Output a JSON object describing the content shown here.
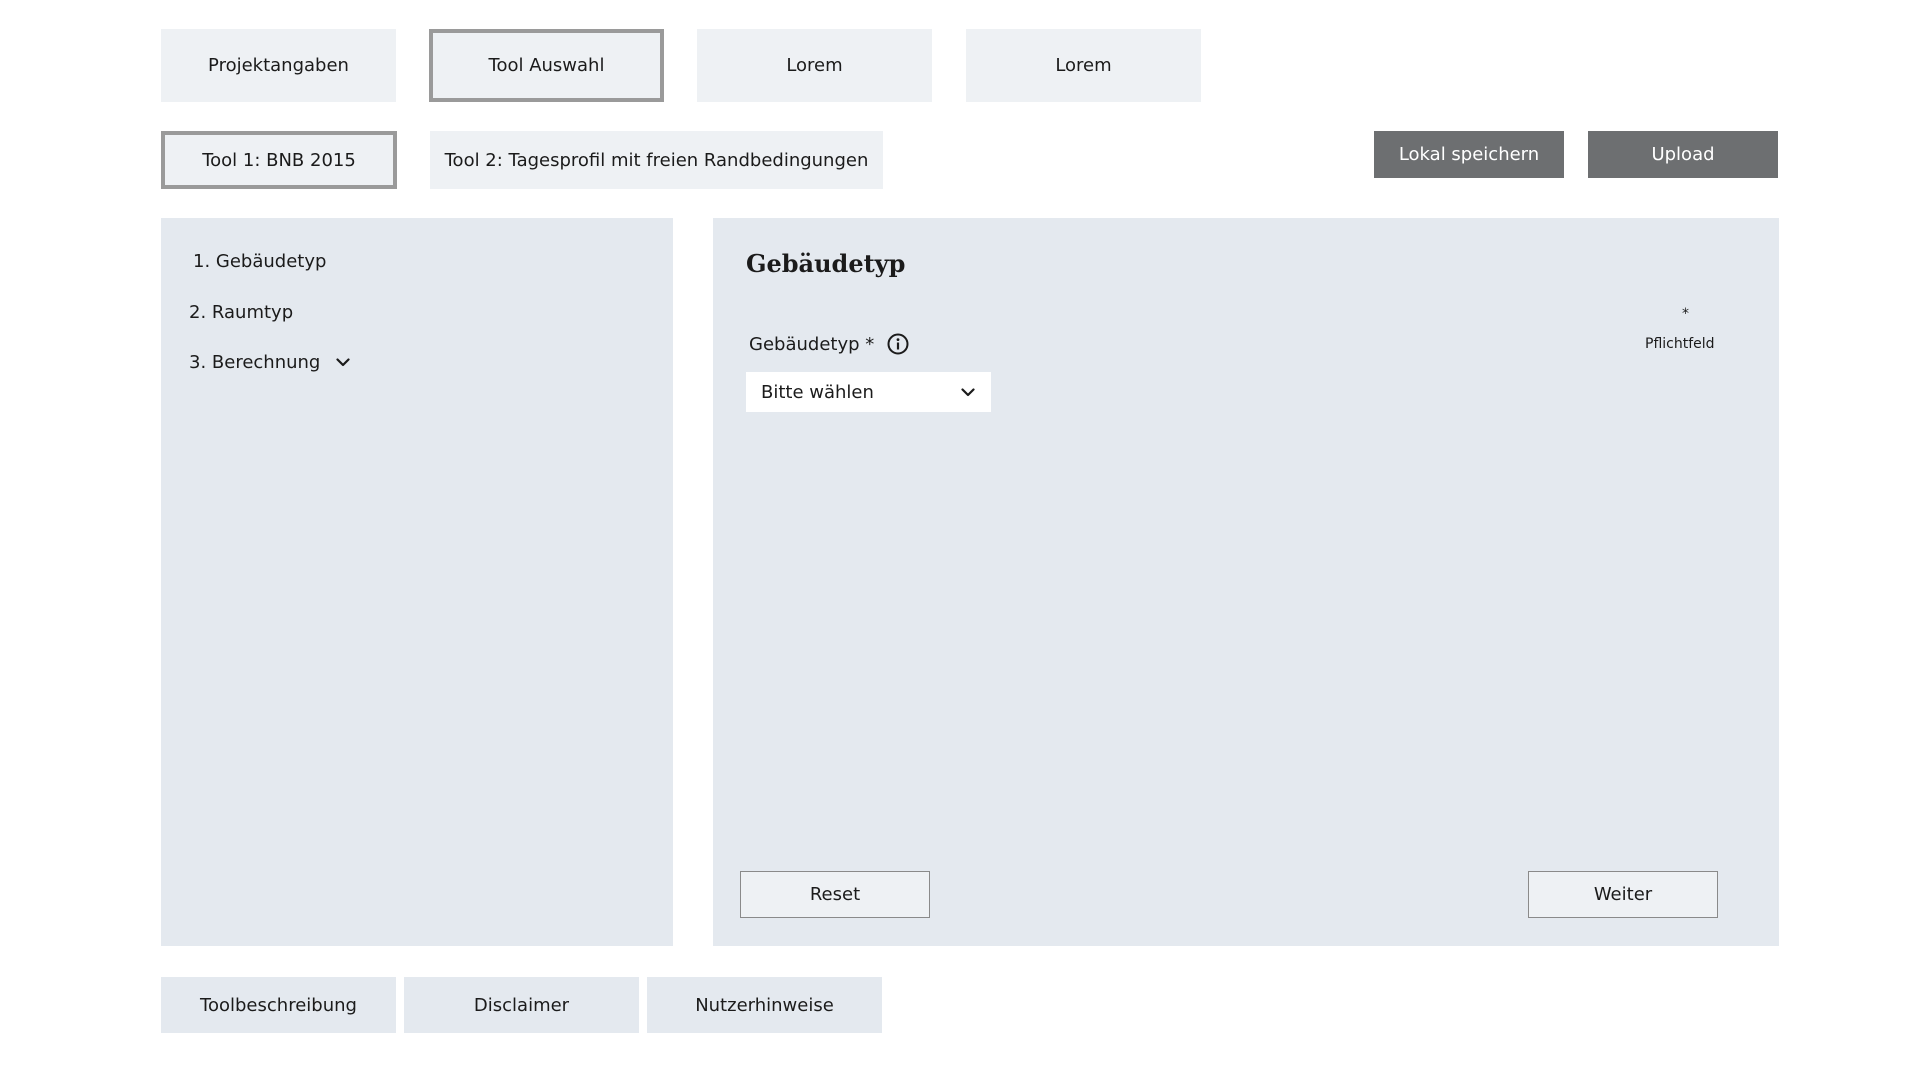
{
  "main_tabs": [
    {
      "label": "Projektangaben",
      "active": false
    },
    {
      "label": "Tool Auswahl",
      "active": true
    },
    {
      "label": "Lorem",
      "active": false
    },
    {
      "label": "Lorem",
      "active": false
    }
  ],
  "tool_tabs": [
    {
      "label": "Tool 1: BNB 2015",
      "active": true
    },
    {
      "label": "Tool 2: Tagesprofil mit freien Randbedingungen",
      "active": false
    }
  ],
  "actions": {
    "save_local": "Lokal speichern",
    "upload": "Upload"
  },
  "sidebar": {
    "items": [
      {
        "label": "1. Gebäudetyp"
      },
      {
        "label": "2. Raumtyp"
      },
      {
        "label": "3. Berechnung",
        "icon": "chevron-down-icon"
      }
    ]
  },
  "content": {
    "title": "Gebäudetyp",
    "field_label": "Gebäudetyp *",
    "required_marker": "*",
    "required_label": "Pflichtfeld",
    "select_value": "Bitte wählen",
    "reset": "Reset",
    "next": "Weiter"
  },
  "footer": {
    "tabs": [
      {
        "label": "Toolbeschreibung"
      },
      {
        "label": "Disclaimer"
      },
      {
        "label": "Nutzerhinweise"
      }
    ]
  },
  "colors": {
    "tab_bg": "#eef1f4",
    "panel_bg": "#e4e9ef",
    "dark_button": "#6d6f71",
    "active_border": "#9a9a9a"
  }
}
